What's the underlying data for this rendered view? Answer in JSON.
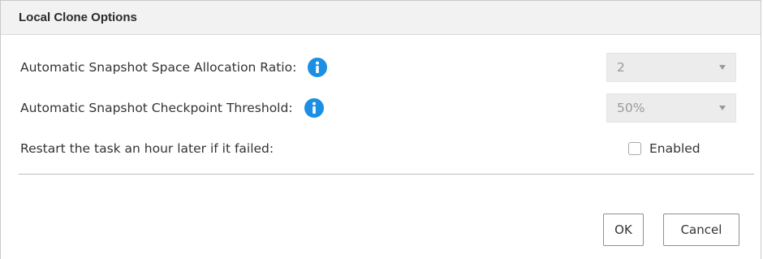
{
  "dialog": {
    "title": "Local Clone Options"
  },
  "settings": [
    {
      "label": "Automatic Snapshot Space Allocation Ratio:",
      "has_info": true,
      "control": "select",
      "value": "2"
    },
    {
      "label": "Automatic Snapshot Checkpoint Threshold:",
      "has_info": true,
      "control": "select",
      "value": "50%"
    },
    {
      "label": "Restart the task an hour later if it failed:",
      "has_info": false,
      "control": "checkbox",
      "checked": false,
      "value": "Enabled"
    }
  ],
  "buttons": {
    "ok": "OK",
    "cancel": "Cancel"
  },
  "icons": {
    "info": "info-icon",
    "dropdown": "chevron-down-icon"
  },
  "colors": {
    "info_icon": "#1a8fe3",
    "titlebar_bg": "#f2f2f2",
    "select_bg": "#ececec"
  }
}
